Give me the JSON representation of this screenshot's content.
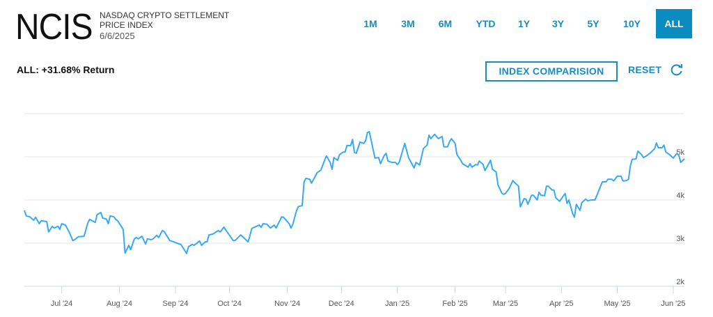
{
  "header": {
    "logo": "NCIS",
    "subtitle_line1": "NASDAQ CRYPTO SETTLEMENT",
    "subtitle_line2": "PRICE INDEX",
    "date": "6/6/2025"
  },
  "tabs": [
    {
      "label": "1M",
      "active": false
    },
    {
      "label": "3M",
      "active": false
    },
    {
      "label": "6M",
      "active": false
    },
    {
      "label": "YTD",
      "active": false
    },
    {
      "label": "1Y",
      "active": false
    },
    {
      "label": "3Y",
      "active": false
    },
    {
      "label": "5Y",
      "active": false
    },
    {
      "label": "10Y",
      "active": false
    },
    {
      "label": "ALL",
      "active": true
    }
  ],
  "return_text": "ALL: +31.68% Return",
  "index_comparison_label": "INDEX COMPARISION",
  "reset_label": "RESET",
  "icons": {
    "reset": "refresh-icon"
  },
  "colors": {
    "accent": "#0a8cc0",
    "line": "#36a9f5",
    "grid": "#e6e6e6"
  },
  "chart_data": {
    "type": "line",
    "title": "",
    "xlabel": "",
    "ylabel": "",
    "ylim": [
      2000,
      6000
    ],
    "xlim": [
      0,
      354
    ],
    "grid": true,
    "y_ticks": [
      {
        "value": 2000,
        "label": "2k"
      },
      {
        "value": 3000,
        "label": "3k"
      },
      {
        "value": 4000,
        "label": "4k"
      },
      {
        "value": 5000,
        "label": "5k"
      },
      {
        "value": 6000,
        "label": ""
      }
    ],
    "x_ticks": [
      {
        "day": 20,
        "label": "Jul '24"
      },
      {
        "day": 51,
        "label": "Aug '24"
      },
      {
        "day": 81,
        "label": "Sep '24"
      },
      {
        "day": 110,
        "label": "Oct '24"
      },
      {
        "day": 141,
        "label": "Nov '24"
      },
      {
        "day": 170,
        "label": "Dec '24"
      },
      {
        "day": 200,
        "label": "Jan '25"
      },
      {
        "day": 231,
        "label": "Feb '25"
      },
      {
        "day": 258,
        "label": "Mar '25"
      },
      {
        "day": 288,
        "label": "Apr '25"
      },
      {
        "day": 318,
        "label": "May '25"
      },
      {
        "day": 348,
        "label": "Jun '25"
      }
    ],
    "series": [
      {
        "name": "NCIS",
        "days": [
          0,
          1,
          3,
          5,
          6,
          8,
          9,
          12,
          13,
          15,
          16,
          18,
          19,
          20,
          22,
          24,
          26,
          27,
          29,
          32,
          34,
          35,
          38,
          39,
          41,
          42,
          44,
          45,
          46,
          48,
          49,
          50,
          53,
          54,
          56,
          57,
          59,
          60,
          61,
          63,
          65,
          66,
          68,
          69,
          71,
          72,
          74,
          75,
          78,
          80,
          83,
          84,
          87,
          88,
          90,
          91,
          94,
          95,
          97,
          98,
          99,
          101,
          104,
          105,
          107,
          112,
          113,
          116,
          120,
          122,
          125,
          126,
          127,
          128,
          130,
          132,
          134,
          135,
          138,
          139,
          141,
          142,
          143,
          144,
          146,
          147,
          149,
          150,
          151,
          153,
          154,
          156,
          157,
          159,
          161,
          162,
          164,
          165,
          166,
          168,
          169,
          171,
          172,
          173,
          175,
          176,
          177,
          178,
          180,
          182,
          183,
          184,
          185,
          188,
          190,
          191,
          193,
          194,
          195,
          197,
          199,
          200,
          201,
          204,
          206,
          209,
          210,
          212,
          213,
          214,
          216,
          217,
          218,
          220,
          222,
          224,
          225,
          227,
          228,
          229,
          231,
          232,
          234,
          235,
          238,
          239,
          240,
          242,
          243,
          244,
          246,
          247,
          250,
          251,
          253,
          254,
          256,
          257,
          258,
          260,
          262,
          263,
          265,
          266,
          268,
          269,
          270,
          272,
          273,
          275,
          276,
          277,
          279,
          280,
          281,
          283,
          284,
          285,
          287,
          290,
          291,
          292,
          294,
          295,
          296,
          298,
          299,
          301,
          302,
          304,
          306,
          307,
          309,
          310,
          312,
          313,
          315,
          316,
          318,
          320,
          321,
          323,
          324,
          325,
          326,
          328,
          329,
          331,
          332,
          334,
          336,
          338,
          339,
          340,
          342,
          343,
          344,
          346,
          348,
          350,
          351,
          352,
          354
        ],
        "values": [
          3760,
          3630,
          3610,
          3530,
          3600,
          3450,
          3520,
          3500,
          3260,
          3390,
          3350,
          3390,
          3320,
          3450,
          3420,
          3260,
          3060,
          3080,
          3150,
          3160,
          3470,
          3550,
          3480,
          3660,
          3710,
          3580,
          3560,
          3450,
          3630,
          3610,
          3550,
          3520,
          3320,
          2770,
          2950,
          2850,
          3100,
          3130,
          3100,
          3160,
          2980,
          3100,
          3080,
          3100,
          3180,
          3130,
          3290,
          3270,
          3060,
          3030,
          2980,
          2970,
          2760,
          2920,
          2970,
          2950,
          3050,
          2950,
          3030,
          3030,
          3190,
          3210,
          3290,
          3260,
          3370,
          3060,
          3060,
          3190,
          3030,
          3340,
          3400,
          3420,
          3370,
          3450,
          3440,
          3350,
          3420,
          3350,
          3610,
          3600,
          3500,
          3450,
          3350,
          3440,
          3760,
          3850,
          3870,
          4420,
          4500,
          4480,
          4390,
          4550,
          4630,
          4690,
          4920,
          5020,
          4870,
          4710,
          4980,
          4920,
          5050,
          5110,
          5110,
          5260,
          5260,
          5400,
          5100,
          5080,
          5340,
          5310,
          5370,
          5560,
          5580,
          4970,
          4980,
          4840,
          5030,
          5080,
          4900,
          4870,
          4870,
          4820,
          4870,
          5310,
          4980,
          4740,
          4870,
          4810,
          5000,
          5190,
          5270,
          5500,
          5420,
          5520,
          5420,
          5470,
          5230,
          5230,
          5350,
          5420,
          5310,
          5050,
          4920,
          4840,
          4760,
          4840,
          4760,
          4820,
          4810,
          4900,
          4820,
          4680,
          4920,
          4710,
          4650,
          4350,
          4160,
          4130,
          4150,
          4270,
          4450,
          4400,
          4320,
          3840,
          4030,
          4020,
          3900,
          4110,
          4110,
          4000,
          4180,
          4110,
          4100,
          4320,
          4320,
          4230,
          4230,
          4050,
          3970,
          4150,
          3920,
          4000,
          3690,
          3600,
          3900,
          3760,
          3940,
          4020,
          3980,
          4000,
          4000,
          4100,
          4320,
          4420,
          4420,
          4480,
          4480,
          4440,
          4550,
          4550,
          4440,
          4450,
          4480,
          4790,
          4940,
          4950,
          5130,
          5050,
          4980,
          5030,
          5100,
          5190,
          5320,
          5210,
          5210,
          5270,
          5110,
          5050,
          4970,
          5080,
          5030,
          4870,
          4950
        ]
      }
    ]
  }
}
